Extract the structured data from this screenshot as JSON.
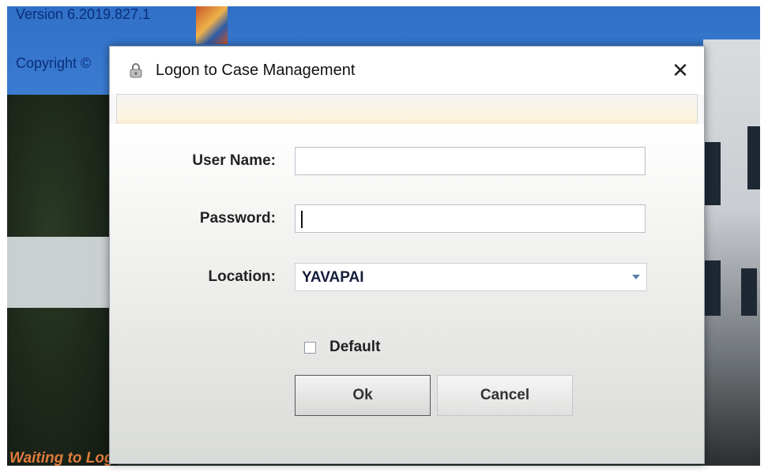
{
  "background": {
    "version_text": "Version 6.2019.827.1",
    "copyright_text": "Copyright ©",
    "status_text": "Waiting to Logon..."
  },
  "dialog": {
    "title": "Logon to Case Management",
    "title_icon": "lock-icon",
    "close_icon": "close-icon",
    "close_glyph": "✕",
    "fields": {
      "username_label": "User Name:",
      "username_value": "",
      "password_label": "Password:",
      "password_value": "",
      "location_label": "Location:",
      "location_value": "YAVAPAI"
    },
    "default_checkbox": {
      "label": "Default",
      "checked": false
    },
    "buttons": {
      "ok_label": "Ok",
      "cancel_label": "Cancel"
    }
  },
  "colors": {
    "text_blue": "#0b2e7a",
    "status_orange": "#e07b3b",
    "dropdown_arrow": "#5a7fa6"
  }
}
